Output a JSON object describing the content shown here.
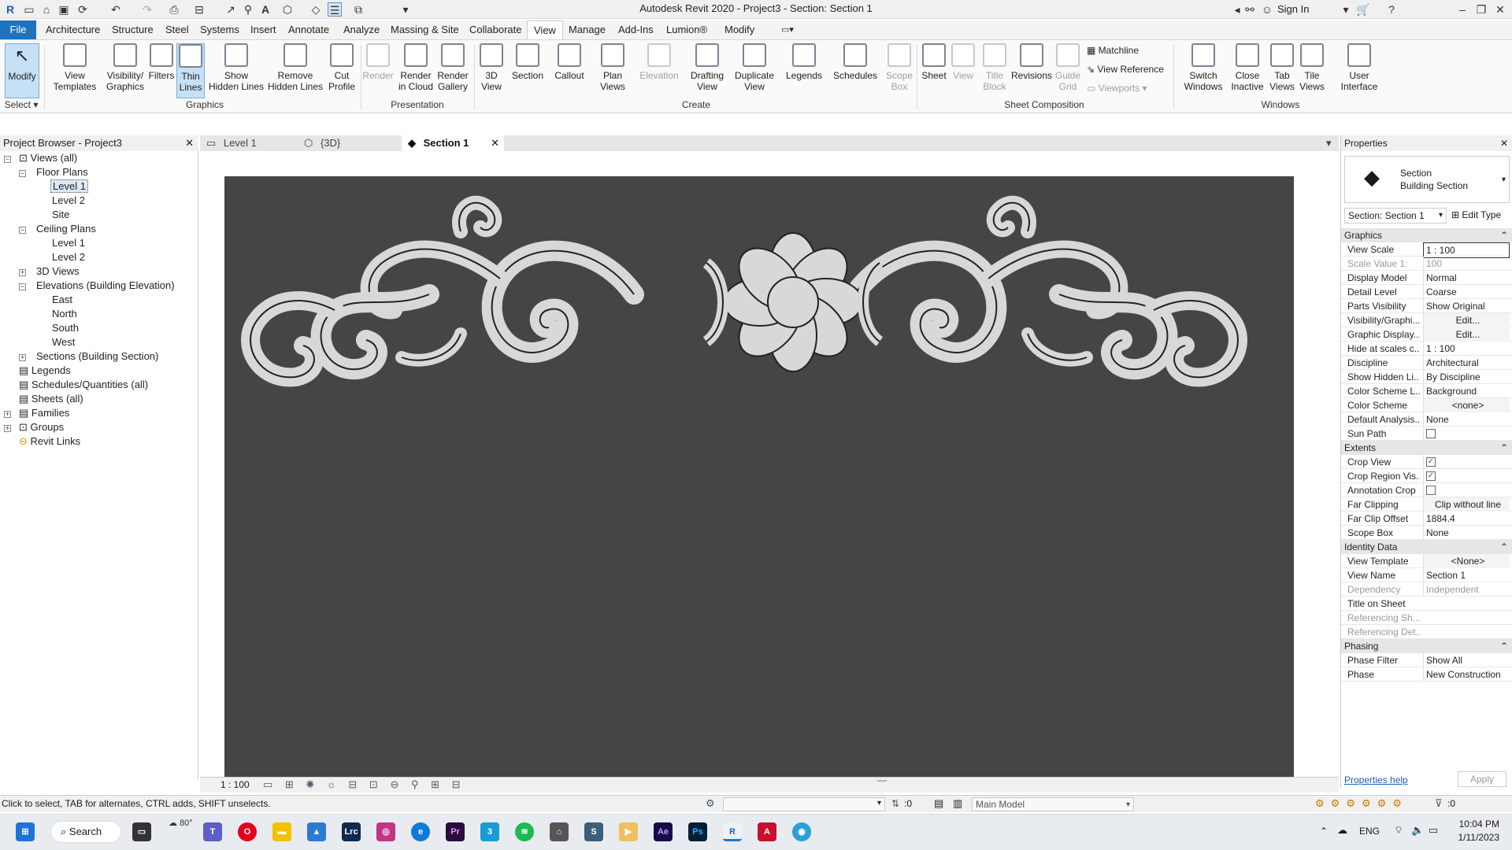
{
  "window": {
    "title": "Autodesk Revit 2020 - Project3 - Section: Section 1",
    "sign_in": "Sign In"
  },
  "ribbon_tabs": [
    "File",
    "Architecture",
    "Structure",
    "Steel",
    "Systems",
    "Insert",
    "Annotate",
    "Analyze",
    "Massing & Site",
    "Collaborate",
    "View",
    "Manage",
    "Add-Ins",
    "Lumion®",
    "Modify"
  ],
  "active_tab": "View",
  "ribbon": {
    "modify": "Modify",
    "select": "Select",
    "graphics": {
      "label": "Graphics",
      "view_templates": "View\nTemplates",
      "visibility_graphics": "Visibility/\nGraphics",
      "filters": "Filters",
      "thin_lines": "Thin\nLines",
      "show_hidden": "Show\nHidden Lines",
      "remove_hidden": "Remove\nHidden Lines",
      "cut_profile": "Cut\nProfile"
    },
    "presentation": {
      "label": "Presentation",
      "render": "Render",
      "render_cloud": "Render\nin Cloud",
      "render_gallery": "Render\nGallery"
    },
    "create": {
      "label": "Create",
      "view_3d": "3D\nView",
      "section": "Section",
      "callout": "Callout",
      "plan_views": "Plan\nViews",
      "elevation": "Elevation",
      "drafting_view": "Drafting\nView",
      "duplicate_view": "Duplicate\nView",
      "legends": "Legends",
      "schedules": "Schedules",
      "scope_box": "Scope\nBox"
    },
    "sheet_composition": {
      "label": "Sheet Composition",
      "sheet": "Sheet",
      "view": "View",
      "title_block": "Title\nBlock",
      "revisions": "Revisions",
      "guide_grid": "Guide\nGrid",
      "matchline": "Matchline",
      "view_reference": "View  Reference",
      "viewports": "Viewports"
    },
    "windows": {
      "label": "Windows",
      "switch_windows": "Switch\nWindows",
      "close_inactive": "Close\nInactive",
      "tab_views": "Tab\nViews",
      "tile_views": "Tile\nViews"
    },
    "user_interface": "User\nInterface"
  },
  "project_browser": {
    "title": "Project Browser - Project3",
    "items": [
      "Views (all)",
      "Floor Plans",
      "Level 1",
      "Level 2",
      "Site",
      "Ceiling Plans",
      "Level 1",
      "Level 2",
      "3D Views",
      "Elevations (Building Elevation)",
      "East",
      "North",
      "South",
      "West",
      "Sections (Building Section)",
      "Legends",
      "Schedules/Quantities (all)",
      "Sheets (all)",
      "Families",
      "Groups",
      "Revit Links"
    ]
  },
  "view_tabs": [
    {
      "label": "Level 1"
    },
    {
      "label": "{3D}"
    },
    {
      "label": "Section 1"
    }
  ],
  "view_control": {
    "scale": "1 : 100"
  },
  "properties": {
    "title": "Properties",
    "type_line1": "Section",
    "type_line2": "Building Section",
    "selector": "Section: Section 1",
    "edit_type": "Edit Type",
    "groups": [
      {
        "name": "Graphics",
        "rows": [
          [
            "View Scale",
            "1 : 100"
          ],
          [
            "Scale Value    1:",
            "100"
          ],
          [
            "Display Model",
            "Normal"
          ],
          [
            "Detail Level",
            "Coarse"
          ],
          [
            "Parts Visibility",
            "Show Original"
          ],
          [
            "Visibility/Graphi...",
            "Edit..."
          ],
          [
            "Graphic Display...",
            "Edit..."
          ],
          [
            "Hide at scales c...",
            "1 : 100"
          ],
          [
            "Discipline",
            "Architectural"
          ],
          [
            "Show Hidden Li...",
            "By Discipline"
          ],
          [
            "Color Scheme L...",
            "Background"
          ],
          [
            "Color Scheme",
            "<none>"
          ],
          [
            "Default Analysis...",
            "None"
          ],
          [
            "Sun Path",
            ""
          ]
        ]
      },
      {
        "name": "Extents",
        "rows": [
          [
            "Crop View",
            ""
          ],
          [
            "Crop Region Vis...",
            ""
          ],
          [
            "Annotation Crop",
            ""
          ],
          [
            "Far Clipping",
            "Clip without line"
          ],
          [
            "Far Clip Offset",
            "1884.4"
          ],
          [
            "Scope Box",
            "None"
          ]
        ]
      },
      {
        "name": "Identity Data",
        "rows": [
          [
            "View Template",
            "<None>"
          ],
          [
            "View Name",
            "Section 1"
          ],
          [
            "Dependency",
            "Independent"
          ],
          [
            "Title on Sheet",
            ""
          ],
          [
            "Referencing Sh...",
            ""
          ],
          [
            "Referencing Det...",
            ""
          ]
        ]
      },
      {
        "name": "Phasing",
        "rows": [
          [
            "Phase Filter",
            "Show All"
          ],
          [
            "Phase",
            "New Construction"
          ]
        ]
      }
    ],
    "help": "Properties help",
    "apply": "Apply"
  },
  "status": {
    "message": "Click to select, TAB for alternates, CTRL adds, SHIFT unselects.",
    "worksets_count": ":0",
    "model": "Main Model",
    "filter_count": ":0"
  },
  "taskbar": {
    "search": "Search",
    "weather": "80°",
    "lang": "ENG",
    "time": "10:04 PM",
    "date": "1/11/2023"
  }
}
